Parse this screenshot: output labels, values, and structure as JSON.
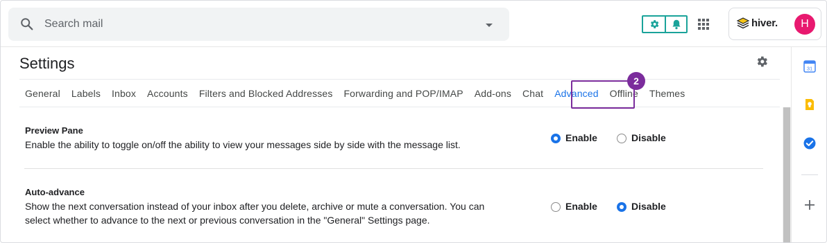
{
  "search": {
    "placeholder": "Search mail",
    "icon": "search-icon",
    "options_icon": "caret-down-icon"
  },
  "hiver_toolbar": {
    "settings_icon": "gear-icon",
    "notifications_icon": "bell-icon",
    "accent": "#1aa39a"
  },
  "apps": {
    "icon": "grid-apps-icon"
  },
  "account": {
    "brand": "hiver.",
    "avatar_initial": "H",
    "avatar_color": "#e8196f"
  },
  "settings": {
    "title": "Settings",
    "tabs": [
      {
        "label": "General"
      },
      {
        "label": "Labels"
      },
      {
        "label": "Inbox"
      },
      {
        "label": "Accounts"
      },
      {
        "label": "Filters and Blocked Addresses"
      },
      {
        "label": "Forwarding and POP/IMAP"
      },
      {
        "label": "Add-ons"
      },
      {
        "label": "Chat"
      },
      {
        "label": "Advanced"
      },
      {
        "label": "Offline"
      },
      {
        "label": "Themes"
      }
    ],
    "active_tab": "Advanced",
    "active_color": "#1a73e8"
  },
  "annotation": {
    "step": "2",
    "color": "#7b2c9c"
  },
  "rows": [
    {
      "title": "Preview Pane",
      "description": "Enable the ability to toggle on/off the ability to view your messages side by side with the message list.",
      "enable_label": "Enable",
      "disable_label": "Disable",
      "selected": "Enable"
    },
    {
      "title": "Auto-advance",
      "description_line1": "Show the next conversation instead of your inbox after you delete, archive or mute a conversation. You can",
      "description_line2": "select whether to advance to the next or previous conversation in the \"General\" Settings page.",
      "enable_label": "Enable",
      "disable_label": "Disable",
      "selected": "Disable"
    }
  ],
  "side_panel": {
    "icons": [
      "calendar-icon",
      "keep-icon",
      "tasks-icon",
      "add-icon"
    ],
    "calendar_day": "31"
  }
}
